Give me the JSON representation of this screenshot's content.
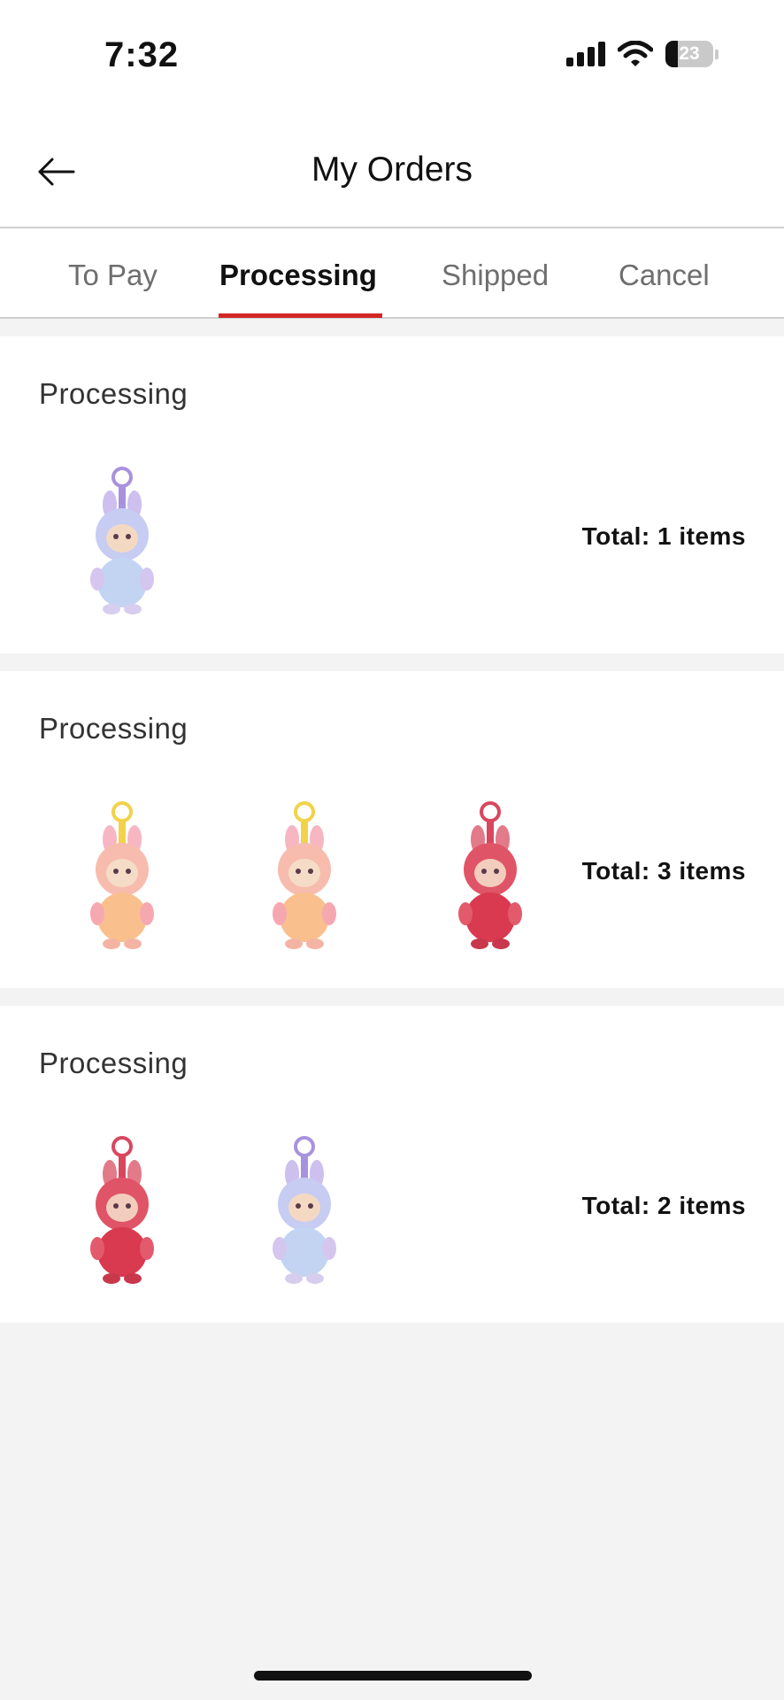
{
  "status_bar": {
    "time": "7:32",
    "battery": "23"
  },
  "header": {
    "title": "My Orders",
    "back_icon": "arrow-left-icon"
  },
  "tabs": [
    {
      "label": "To Pay",
      "active": false
    },
    {
      "label": "Processing",
      "active": true
    },
    {
      "label": "Shipped",
      "active": false
    },
    {
      "label": "Cancel",
      "active": false
    }
  ],
  "colors": {
    "accent": "#d32626",
    "text": "#111111",
    "muted": "#6e6e6e",
    "background": "#f3f3f3"
  },
  "orders": [
    {
      "status": "Processing",
      "total": "Total: 1 items",
      "items": [
        "lavender-blue plush keychain"
      ]
    },
    {
      "status": "Processing",
      "total": "Total: 3 items",
      "items": [
        "peach-yellow plush keychain",
        "peach-yellow plush keychain",
        "red plush keychain"
      ]
    },
    {
      "status": "Processing",
      "total": "Total: 2 items",
      "items": [
        "red plush keychain",
        "lavender-blue plush keychain"
      ]
    }
  ]
}
